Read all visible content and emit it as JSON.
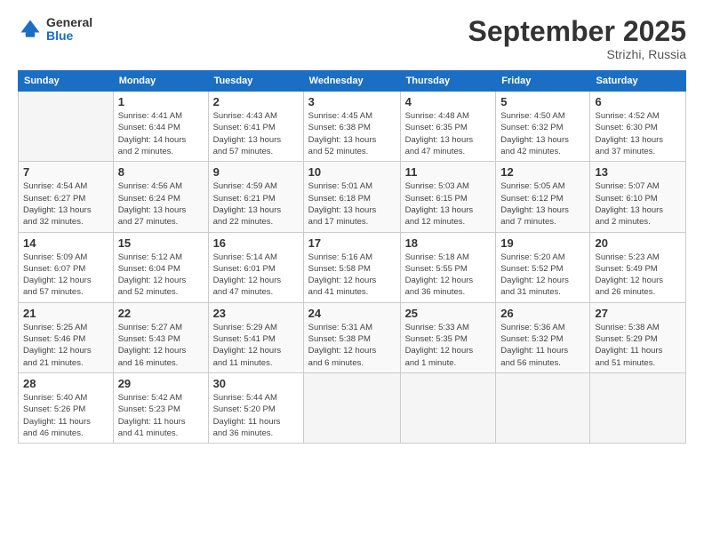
{
  "header": {
    "logo_general": "General",
    "logo_blue": "Blue",
    "month": "September 2025",
    "location": "Strizhi, Russia"
  },
  "weekdays": [
    "Sunday",
    "Monday",
    "Tuesday",
    "Wednesday",
    "Thursday",
    "Friday",
    "Saturday"
  ],
  "weeks": [
    [
      {
        "day": "",
        "info": ""
      },
      {
        "day": "1",
        "info": "Sunrise: 4:41 AM\nSunset: 6:44 PM\nDaylight: 14 hours\nand 2 minutes."
      },
      {
        "day": "2",
        "info": "Sunrise: 4:43 AM\nSunset: 6:41 PM\nDaylight: 13 hours\nand 57 minutes."
      },
      {
        "day": "3",
        "info": "Sunrise: 4:45 AM\nSunset: 6:38 PM\nDaylight: 13 hours\nand 52 minutes."
      },
      {
        "day": "4",
        "info": "Sunrise: 4:48 AM\nSunset: 6:35 PM\nDaylight: 13 hours\nand 47 minutes."
      },
      {
        "day": "5",
        "info": "Sunrise: 4:50 AM\nSunset: 6:32 PM\nDaylight: 13 hours\nand 42 minutes."
      },
      {
        "day": "6",
        "info": "Sunrise: 4:52 AM\nSunset: 6:30 PM\nDaylight: 13 hours\nand 37 minutes."
      }
    ],
    [
      {
        "day": "7",
        "info": "Sunrise: 4:54 AM\nSunset: 6:27 PM\nDaylight: 13 hours\nand 32 minutes."
      },
      {
        "day": "8",
        "info": "Sunrise: 4:56 AM\nSunset: 6:24 PM\nDaylight: 13 hours\nand 27 minutes."
      },
      {
        "day": "9",
        "info": "Sunrise: 4:59 AM\nSunset: 6:21 PM\nDaylight: 13 hours\nand 22 minutes."
      },
      {
        "day": "10",
        "info": "Sunrise: 5:01 AM\nSunset: 6:18 PM\nDaylight: 13 hours\nand 17 minutes."
      },
      {
        "day": "11",
        "info": "Sunrise: 5:03 AM\nSunset: 6:15 PM\nDaylight: 13 hours\nand 12 minutes."
      },
      {
        "day": "12",
        "info": "Sunrise: 5:05 AM\nSunset: 6:12 PM\nDaylight: 13 hours\nand 7 minutes."
      },
      {
        "day": "13",
        "info": "Sunrise: 5:07 AM\nSunset: 6:10 PM\nDaylight: 13 hours\nand 2 minutes."
      }
    ],
    [
      {
        "day": "14",
        "info": "Sunrise: 5:09 AM\nSunset: 6:07 PM\nDaylight: 12 hours\nand 57 minutes."
      },
      {
        "day": "15",
        "info": "Sunrise: 5:12 AM\nSunset: 6:04 PM\nDaylight: 12 hours\nand 52 minutes."
      },
      {
        "day": "16",
        "info": "Sunrise: 5:14 AM\nSunset: 6:01 PM\nDaylight: 12 hours\nand 47 minutes."
      },
      {
        "day": "17",
        "info": "Sunrise: 5:16 AM\nSunset: 5:58 PM\nDaylight: 12 hours\nand 41 minutes."
      },
      {
        "day": "18",
        "info": "Sunrise: 5:18 AM\nSunset: 5:55 PM\nDaylight: 12 hours\nand 36 minutes."
      },
      {
        "day": "19",
        "info": "Sunrise: 5:20 AM\nSunset: 5:52 PM\nDaylight: 12 hours\nand 31 minutes."
      },
      {
        "day": "20",
        "info": "Sunrise: 5:23 AM\nSunset: 5:49 PM\nDaylight: 12 hours\nand 26 minutes."
      }
    ],
    [
      {
        "day": "21",
        "info": "Sunrise: 5:25 AM\nSunset: 5:46 PM\nDaylight: 12 hours\nand 21 minutes."
      },
      {
        "day": "22",
        "info": "Sunrise: 5:27 AM\nSunset: 5:43 PM\nDaylight: 12 hours\nand 16 minutes."
      },
      {
        "day": "23",
        "info": "Sunrise: 5:29 AM\nSunset: 5:41 PM\nDaylight: 12 hours\nand 11 minutes."
      },
      {
        "day": "24",
        "info": "Sunrise: 5:31 AM\nSunset: 5:38 PM\nDaylight: 12 hours\nand 6 minutes."
      },
      {
        "day": "25",
        "info": "Sunrise: 5:33 AM\nSunset: 5:35 PM\nDaylight: 12 hours\nand 1 minute."
      },
      {
        "day": "26",
        "info": "Sunrise: 5:36 AM\nSunset: 5:32 PM\nDaylight: 11 hours\nand 56 minutes."
      },
      {
        "day": "27",
        "info": "Sunrise: 5:38 AM\nSunset: 5:29 PM\nDaylight: 11 hours\nand 51 minutes."
      }
    ],
    [
      {
        "day": "28",
        "info": "Sunrise: 5:40 AM\nSunset: 5:26 PM\nDaylight: 11 hours\nand 46 minutes."
      },
      {
        "day": "29",
        "info": "Sunrise: 5:42 AM\nSunset: 5:23 PM\nDaylight: 11 hours\nand 41 minutes."
      },
      {
        "day": "30",
        "info": "Sunrise: 5:44 AM\nSunset: 5:20 PM\nDaylight: 11 hours\nand 36 minutes."
      },
      {
        "day": "",
        "info": ""
      },
      {
        "day": "",
        "info": ""
      },
      {
        "day": "",
        "info": ""
      },
      {
        "day": "",
        "info": ""
      }
    ]
  ]
}
